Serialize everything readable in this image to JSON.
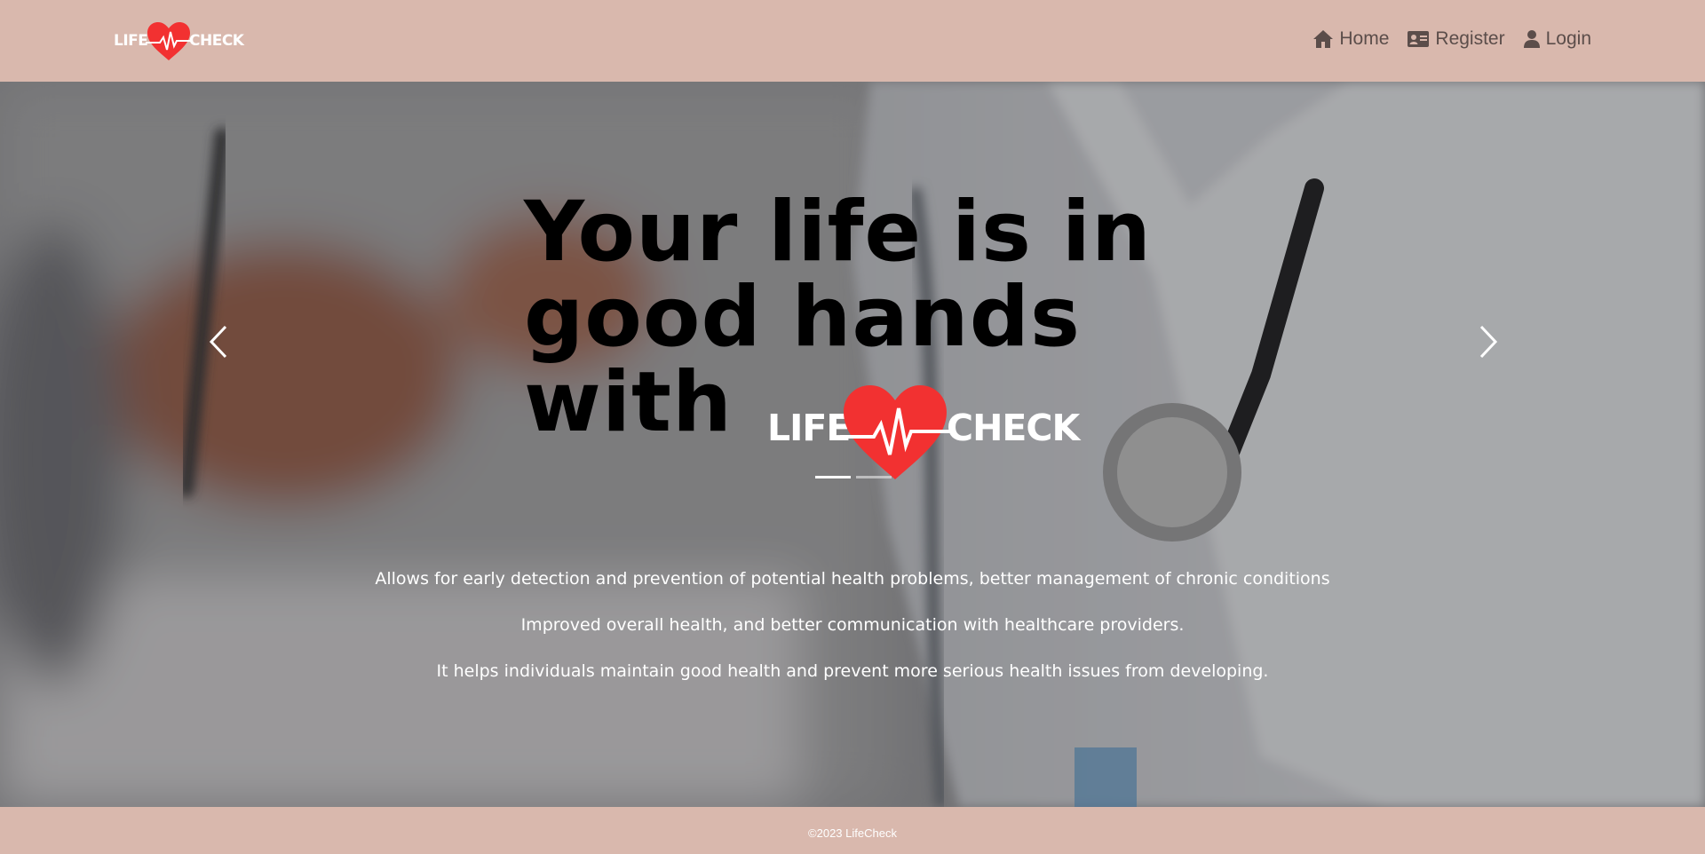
{
  "header": {
    "logo": {
      "word_left": "LIFE",
      "word_right": "CHECK",
      "heart_color": "#f23131"
    },
    "nav": [
      {
        "label": "Home",
        "icon": "home-icon"
      },
      {
        "label": "Register",
        "icon": "id-card-icon"
      },
      {
        "label": "Login",
        "icon": "user-icon"
      }
    ]
  },
  "hero": {
    "headline": [
      "Your life is in",
      "good hands",
      "with"
    ],
    "logo": {
      "word_left": "LIFE",
      "word_right": "CHECK",
      "heart_color": "#f23131"
    },
    "carousel": {
      "slides": 2,
      "active_index": 0,
      "prev_icon": "chevron-left-icon",
      "next_icon": "chevron-right-icon"
    },
    "descriptions": [
      "Allows for early detection and prevention of potential health problems, better management of chronic conditions",
      "Improved overall health, and better communication with healthcare providers.",
      "It helps individuals maintain good health and prevent more serious health issues from developing."
    ]
  },
  "footer": {
    "copyright": "©2023 LifeCheck"
  },
  "colors": {
    "header_bg": "#d9b8ad",
    "nav_text": "#5b4d4a",
    "brand_red": "#f23131",
    "headline": "#000000",
    "hero_text": "#ffffff"
  }
}
